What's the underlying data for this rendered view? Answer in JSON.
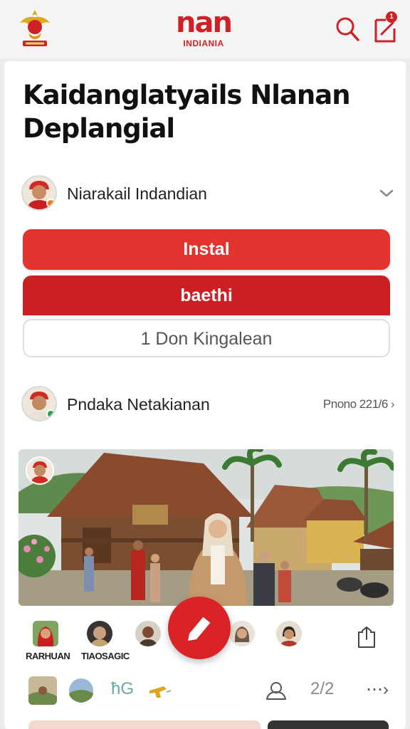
{
  "header": {
    "brand_name": "nan",
    "brand_sub": "INDIANIA",
    "notification_count": "1",
    "accent_color": "#cf2027"
  },
  "article": {
    "title": "Kaidanglatyails Nlanan Deplangial"
  },
  "author": {
    "name": "Niarakail Indandian",
    "avatar_icon": "person-avatar-icon",
    "status_color": "#f07b1f"
  },
  "buttons": {
    "install_label": "Instal",
    "second_label": "baethi",
    "outline_label": "1 Don Kingalean"
  },
  "post": {
    "name": "Pndaka Netakianan",
    "meta": "Pnono 221/6",
    "status_color": "#2aa34a"
  },
  "stories": {
    "labels": [
      "RARHUAN",
      "TIAOSAGIC"
    ]
  },
  "bottom_bar": {
    "label_a": "ħG",
    "label_b": "2/2",
    "more": "⋯›"
  }
}
